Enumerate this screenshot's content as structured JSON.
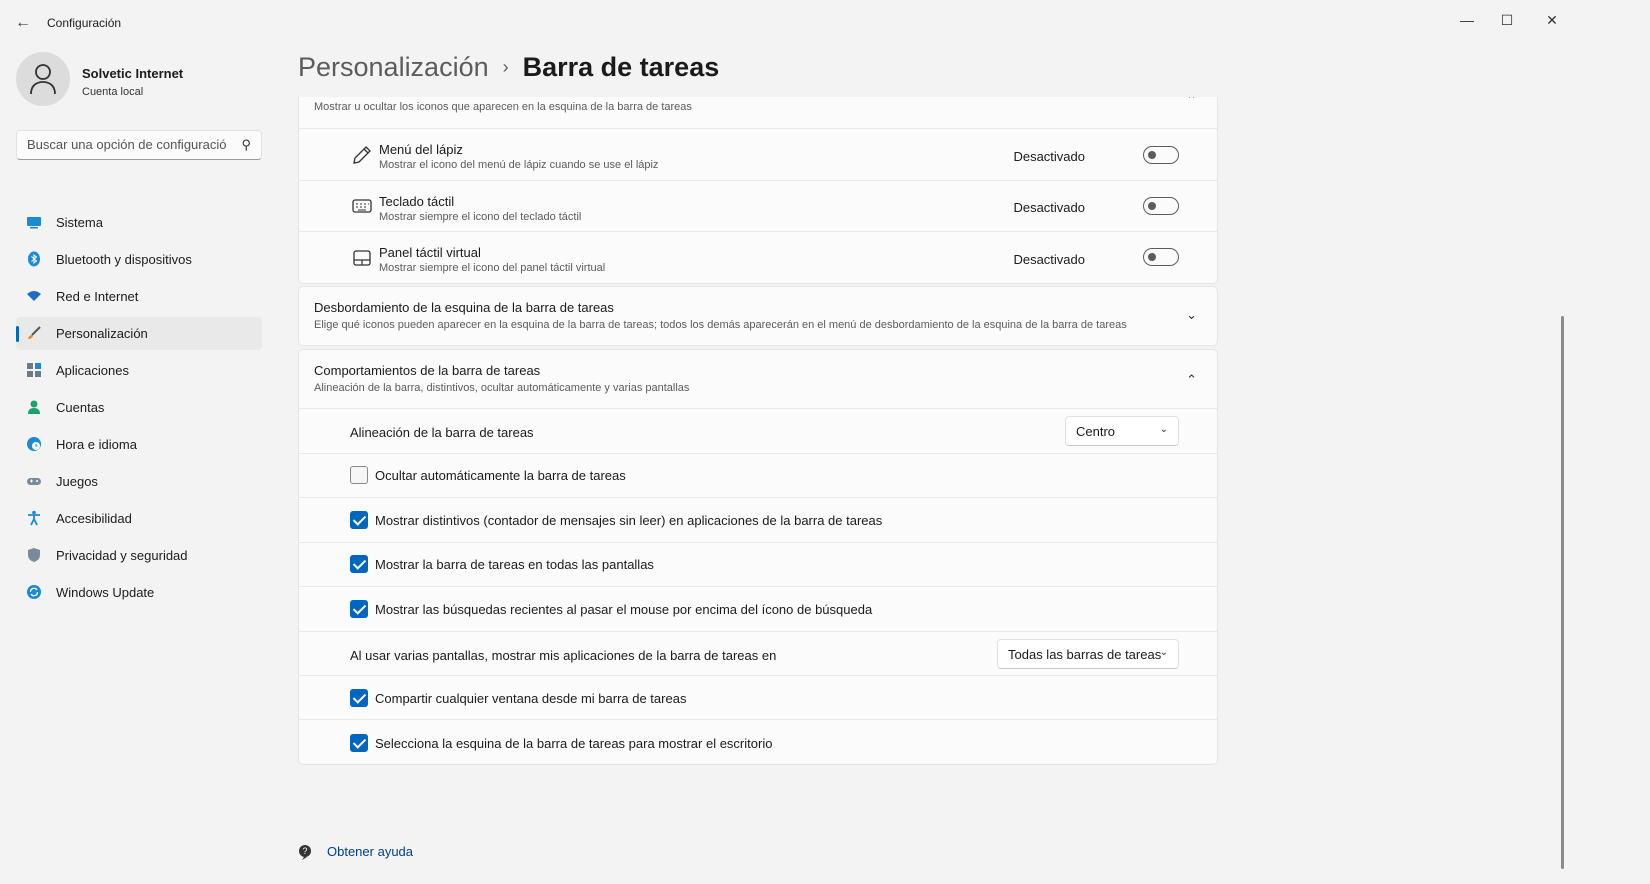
{
  "window": {
    "title": "Configuración"
  },
  "profile": {
    "name": "Solvetic Internet",
    "subtitle": "Cuenta local"
  },
  "search": {
    "placeholder": "Buscar una opción de configuración"
  },
  "sidebar": {
    "items": [
      {
        "label": "Sistema",
        "icon": "system-icon"
      },
      {
        "label": "Bluetooth y dispositivos",
        "icon": "bluetooth-icon"
      },
      {
        "label": "Red e Internet",
        "icon": "wifi-icon"
      },
      {
        "label": "Personalización",
        "icon": "brush-icon",
        "active": true
      },
      {
        "label": "Aplicaciones",
        "icon": "apps-icon"
      },
      {
        "label": "Cuentas",
        "icon": "person-icon"
      },
      {
        "label": "Hora e idioma",
        "icon": "clock-globe-icon"
      },
      {
        "label": "Juegos",
        "icon": "gamepad-icon"
      },
      {
        "label": "Accesibilidad",
        "icon": "accessibility-icon"
      },
      {
        "label": "Privacidad y seguridad",
        "icon": "shield-icon"
      },
      {
        "label": "Windows Update",
        "icon": "update-icon"
      }
    ]
  },
  "breadcrumb": {
    "parent": "Personalización",
    "separator": "›",
    "current": "Barra de tareas"
  },
  "tray_icons": {
    "desc": "Mostrar u ocultar los iconos que aparecen en la esquina de la barra de tareas",
    "rows": [
      {
        "title": "Menú del lápiz",
        "desc": "Mostrar el icono del menú de lápiz cuando se use el lápiz",
        "state": "Desactivado",
        "on": false
      },
      {
        "title": "Teclado táctil",
        "desc": "Mostrar siempre el icono del teclado táctil",
        "state": "Desactivado",
        "on": false
      },
      {
        "title": "Panel táctil virtual",
        "desc": "Mostrar siempre el icono del panel táctil virtual",
        "state": "Desactivado",
        "on": false
      }
    ]
  },
  "overflow": {
    "title": "Desbordamiento de la esquina de la barra de tareas",
    "desc": "Elige qué iconos pueden aparecer en la esquina de la barra de tareas; todos los demás aparecerán en el menú de desbordamiento de la esquina de la barra de tareas"
  },
  "behaviors": {
    "title": "Comportamientos de la barra de tareas",
    "desc": "Alineación de la barra, distintivos, ocultar automáticamente y varias pantallas",
    "alignment_label": "Alineación de la barra de tareas",
    "alignment_value": "Centro",
    "autohide": {
      "label": "Ocultar automáticamente la barra de tareas",
      "checked": false
    },
    "badges": {
      "label": "Mostrar distintivos (contador de mensajes sin leer) en aplicaciones de la barra de tareas",
      "checked": true
    },
    "all_displays": {
      "label": "Mostrar la barra de tareas en todas las pantallas",
      "checked": true
    },
    "recent_searches": {
      "label": "Mostrar las búsquedas recientes al pasar el mouse por encima del ícono de búsqueda",
      "checked": true
    },
    "multi_display_label": "Al usar varias pantallas, mostrar mis aplicaciones de la barra de tareas en",
    "multi_display_value": "Todas las barras de tareas",
    "share_window": {
      "label": "Compartir cualquier ventana desde mi barra de tareas",
      "checked": true
    },
    "far_corner": {
      "label": "Selecciona la esquina de la barra de tareas para mostrar el escritorio",
      "checked": true
    }
  },
  "help": {
    "label": "Obtener ayuda"
  },
  "colors": {
    "accent": "#0067c0",
    "background": "#f3f3f3",
    "card": "#fbfbfb"
  }
}
